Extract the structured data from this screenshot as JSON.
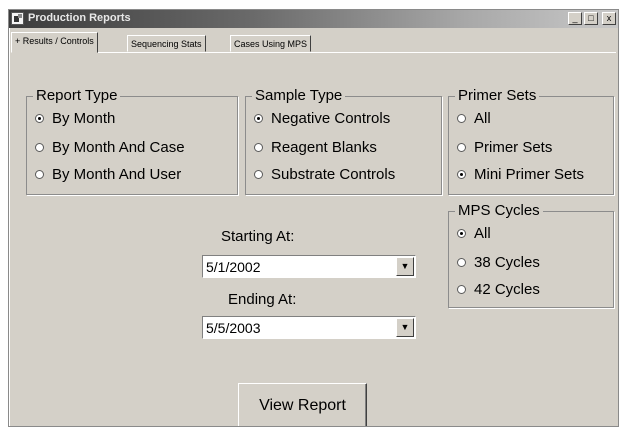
{
  "window": {
    "title": "Production Reports",
    "controls": {
      "minimize": "_",
      "maximize": "□",
      "close": "x"
    }
  },
  "tabs": [
    {
      "label": "+ Results / Controls",
      "active": true
    },
    {
      "label": "Sequencing Stats",
      "active": false
    },
    {
      "label": "Cases Using MPS",
      "active": false
    }
  ],
  "report_type": {
    "title": "Report Type",
    "options": [
      {
        "label": "By Month",
        "checked": true
      },
      {
        "label": "By Month And Case",
        "checked": false
      },
      {
        "label": "By Month And User",
        "checked": false
      }
    ]
  },
  "sample_type": {
    "title": "Sample Type",
    "options": [
      {
        "label": "Negative Controls",
        "checked": true
      },
      {
        "label": "Reagent Blanks",
        "checked": false
      },
      {
        "label": "Substrate Controls",
        "checked": false
      }
    ]
  },
  "primer_sets": {
    "title": "Primer Sets",
    "options": [
      {
        "label": "All",
        "checked": false
      },
      {
        "label": "Primer Sets",
        "checked": false
      },
      {
        "label": "Mini Primer Sets",
        "checked": true
      }
    ]
  },
  "mps_cycles": {
    "title": "MPS Cycles",
    "options": [
      {
        "label": "All",
        "checked": true
      },
      {
        "label": "38 Cycles",
        "checked": false
      },
      {
        "label": "42 Cycles",
        "checked": false
      }
    ]
  },
  "starting": {
    "label": "Starting At:",
    "value": "5/1/2002"
  },
  "ending": {
    "label": "Ending At:",
    "value": "5/5/2003"
  },
  "view_report_label": "View Report"
}
